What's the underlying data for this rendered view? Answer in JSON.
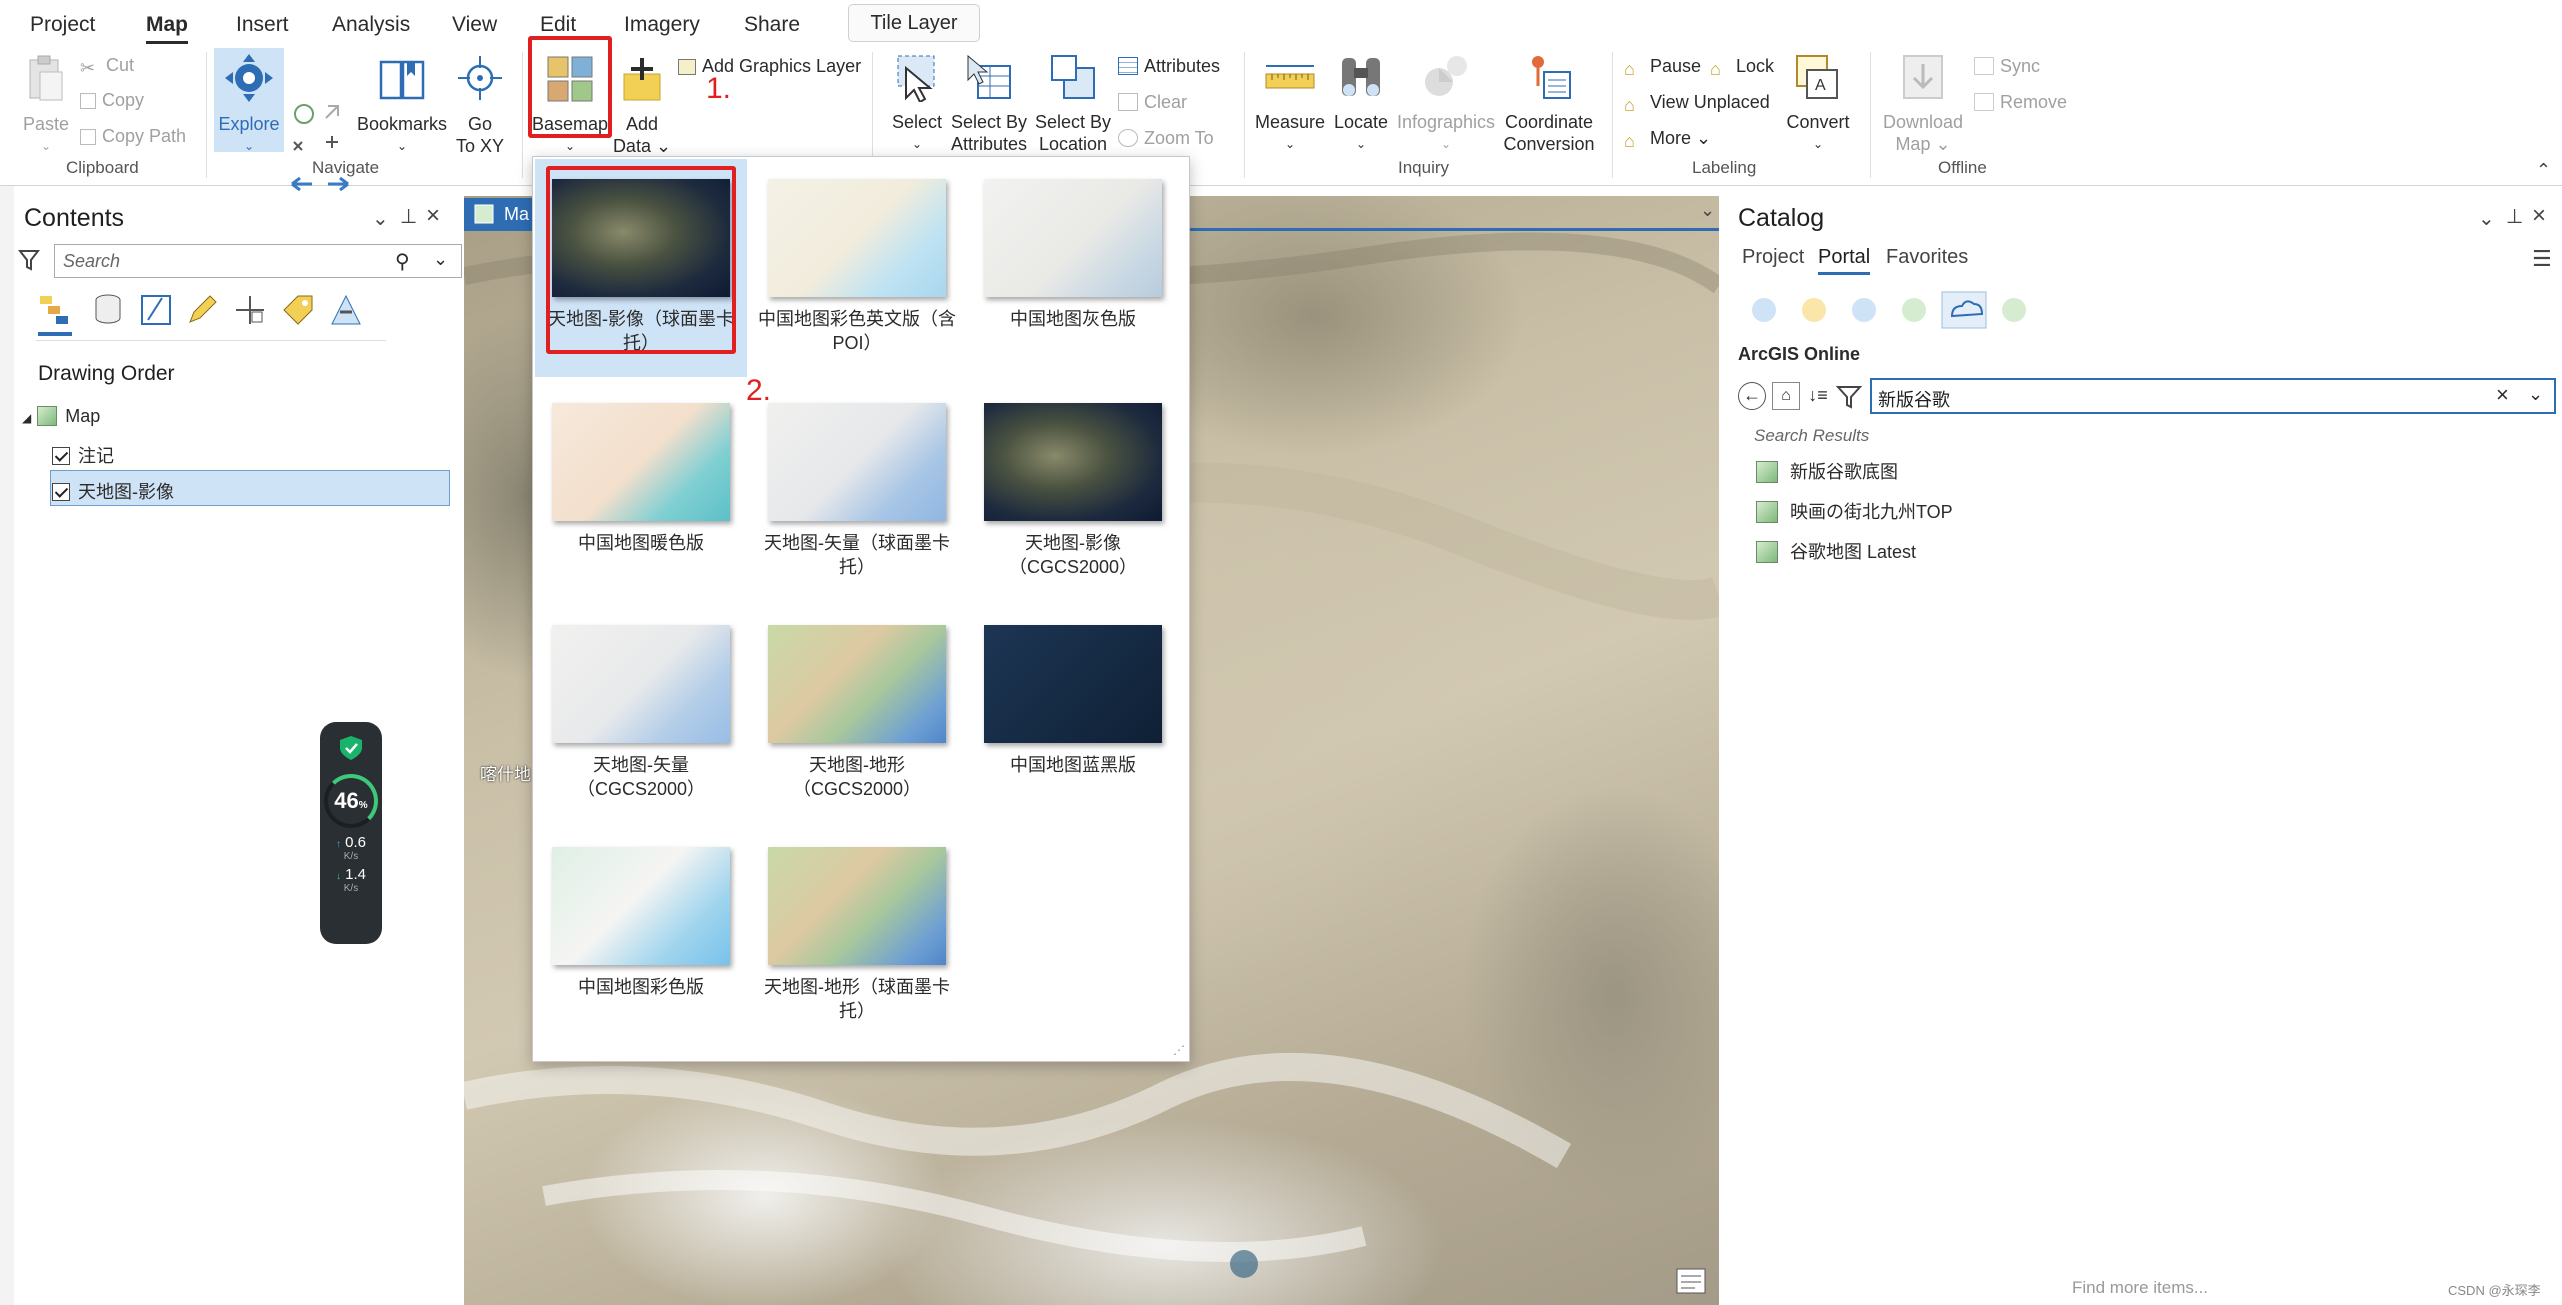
{
  "ribbon_tabs": {
    "project": "Project",
    "map": "Map",
    "insert": "Insert",
    "analysis": "Analysis",
    "view": "View",
    "edit": "Edit",
    "imagery": "Imagery",
    "share": "Share",
    "context": "Tile Layer"
  },
  "clipboard": {
    "paste": "Paste",
    "cut": "Cut",
    "copy": "Copy",
    "copy_path": "Copy Path",
    "group": "Clipboard"
  },
  "navigate": {
    "explore": "Explore",
    "bookmarks": "Bookmarks",
    "go_to_xy": "Go\nTo XY",
    "go": "Go",
    "to_xy": "To XY",
    "group": "Navigate"
  },
  "layer": {
    "basemap": "Basemap",
    "add": "Add",
    "data": "Data",
    "add_graphics_layer": "Add Graphics Layer"
  },
  "selection": {
    "select": "Select",
    "select_by": "Select By",
    "attributes": "Attributes",
    "select_by2": "Select By",
    "location": "Location",
    "attributes_btn": "Attributes",
    "clear": "Clear",
    "zoom_to": "Zoom To"
  },
  "inquiry": {
    "measure": "Measure",
    "locate": "Locate",
    "infographics": "Infographics",
    "coordinate": "Coordinate",
    "conversion": "Conversion",
    "group": "Inquiry"
  },
  "labeling": {
    "pause": "Pause",
    "lock": "Lock",
    "view_unplaced": "View Unplaced",
    "more": "More",
    "convert": "Convert",
    "group": "Labeling"
  },
  "offline": {
    "download": "Download",
    "map": "Map",
    "sync": "Sync",
    "remove": "Remove",
    "group": "Offline"
  },
  "annotations": {
    "step1": "1.",
    "step2": "2."
  },
  "contents": {
    "title": "Contents",
    "search_placeholder": "Search",
    "drawing_order": "Drawing Order",
    "map_node": "Map",
    "layer1": "注记",
    "layer2": "天地图-影像"
  },
  "map_view": {
    "tab_label": "Ma"
  },
  "gallery": {
    "items": [
      {
        "label": "天地图-影像（球面墨卡托）"
      },
      {
        "label": "中国地图彩色英文版（含POI）"
      },
      {
        "label": "中国地图灰色版"
      },
      {
        "label": "中国地图暖色版"
      },
      {
        "label": "天地图-矢量（球面墨卡托）"
      },
      {
        "label": "天地图-影像（CGCS2000）"
      },
      {
        "label": "天地图-矢量（CGCS2000）"
      },
      {
        "label": "天地图-地形（CGCS2000）"
      },
      {
        "label": "中国地图蓝黑版"
      },
      {
        "label": "中国地图彩色版"
      },
      {
        "label": "天地图-地形（球面墨卡托）"
      }
    ]
  },
  "catalog": {
    "title": "Catalog",
    "tabs": {
      "project": "Project",
      "portal": "Portal",
      "favorites": "Favorites"
    },
    "source": "ArcGIS Online",
    "search_value": "新版谷歌",
    "results_label": "Search Results",
    "results": [
      "新版谷歌底图",
      "映画の街北九州TOP",
      "谷歌地图 Latest"
    ],
    "find_more": "Find more items..."
  },
  "widget": {
    "percent": "46",
    "pct_sign": "%",
    "up": "0.6",
    "up_unit": "K/s",
    "down": "1.4",
    "down_unit": "K/s"
  },
  "map_label": "喀什地",
  "watermark": "CSDN @永琛李",
  "colors": {
    "accent": "#2e6db4",
    "highlight": "#e02020",
    "selection": "#cfe3f7"
  }
}
